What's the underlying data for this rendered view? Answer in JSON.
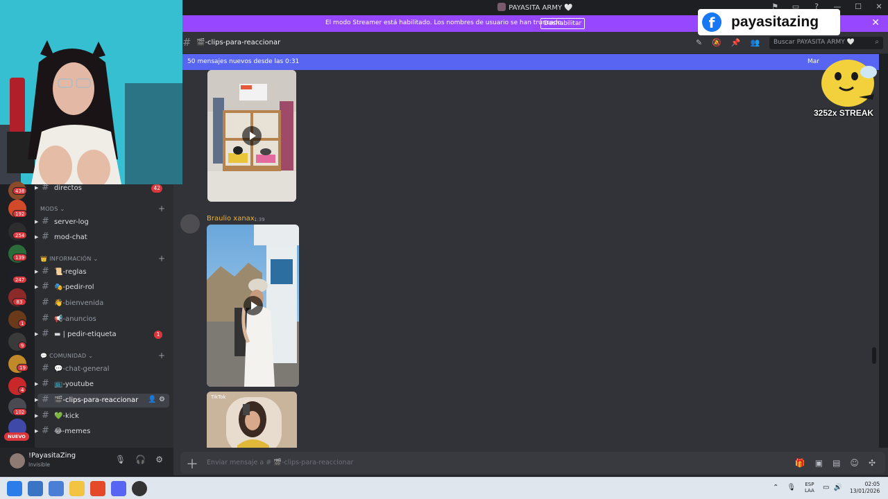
{
  "window": {
    "title": "PAYASITA ARMY 🤍"
  },
  "streamer_banner": {
    "text": "El modo Streamer está habilitado. Los nombres de usuario se han truncado.",
    "button": "Deshabilitar"
  },
  "channel_header": {
    "name": "🎬-clips-para-reaccionar",
    "search_placeholder": "Buscar PAYASITA ARMY 🤍"
  },
  "new_messages": {
    "text": "50 mensajes nuevos desde las 0:31",
    "mark_read": "Mar"
  },
  "message": {
    "author": "Braulio xanax",
    "time": "1:39",
    "tiktok_label": "TikTok"
  },
  "composer": {
    "placeholder": "Enviar mensaje a # 🎬-clips-para-reaccionar"
  },
  "overlay": {
    "facebook_handle": "payasitazing",
    "streak": "3252x STREAK"
  },
  "server_badges": [
    "438",
    "192",
    "254",
    "139",
    "247",
    "83",
    "1",
    "9",
    "19",
    "4",
    "102"
  ],
  "new_label": "NUEVO",
  "channels": [
    {
      "label": "directos",
      "count": "42"
    },
    {
      "label": "server-log"
    },
    {
      "label": "mod-chat"
    },
    {
      "label": "📜-reglas"
    },
    {
      "label": "🎭-pedir-rol"
    },
    {
      "label": "👋-bienvenida"
    },
    {
      "label": "📢-anuncios"
    },
    {
      "label": "▬ | pedir-etiqueta",
      "count": "1"
    },
    {
      "label": "💬-chat-general"
    },
    {
      "label": "📺-youtube"
    },
    {
      "label": "🎬-clips-para-reaccionar"
    },
    {
      "label": "💚-kick"
    },
    {
      "label": "😂-memes"
    }
  ],
  "categories": {
    "mods": "MODS",
    "info": "INFORMACIÓN",
    "community": "COMUNIDAD"
  },
  "user": {
    "name": "!PayasitaZing",
    "status": "Invisible"
  },
  "taskbar": {
    "lang1": "ESP",
    "lang2": "LAA",
    "time": "02:05",
    "date": "13/01/2026"
  }
}
